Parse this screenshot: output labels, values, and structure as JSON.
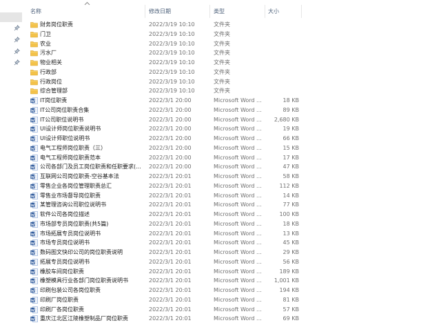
{
  "header": {
    "name_label": "名称",
    "date_label": "修改日期",
    "type_label": "类型",
    "size_label": "大小"
  },
  "icons": {
    "folder": "folder-icon",
    "word": "word-document-icon",
    "pin": "pin-icon",
    "sort": "chevron-up-icon"
  },
  "colors": {
    "folder": "#f3c24a",
    "word": "#2b579a",
    "selection": "#e5e5e5",
    "header_text": "#4c607a"
  },
  "files": [
    {
      "name": "财务岗位职责",
      "date": "2022/3/19 10:10",
      "type": "文件夹",
      "size": "",
      "kind": "folder"
    },
    {
      "name": "门卫",
      "date": "2022/3/19 10:10",
      "type": "文件夹",
      "size": "",
      "kind": "folder"
    },
    {
      "name": "农业",
      "date": "2022/3/19 10:10",
      "type": "文件夹",
      "size": "",
      "kind": "folder"
    },
    {
      "name": "污水厂",
      "date": "2022/3/19 10:10",
      "type": "文件夹",
      "size": "",
      "kind": "folder"
    },
    {
      "name": "物业相关",
      "date": "2022/3/19 10:10",
      "type": "文件夹",
      "size": "",
      "kind": "folder"
    },
    {
      "name": "行政部",
      "date": "2022/3/19 10:10",
      "type": "文件夹",
      "size": "",
      "kind": "folder"
    },
    {
      "name": "行政岗位",
      "date": "2022/3/19 10:10",
      "type": "文件夹",
      "size": "",
      "kind": "folder"
    },
    {
      "name": "综合管理部",
      "date": "2022/3/19 10:10",
      "type": "文件夹",
      "size": "",
      "kind": "folder"
    },
    {
      "name": "IT岗位职责",
      "date": "2022/3/1 20:00",
      "type": "Microsoft Word ...",
      "size": "18 KB",
      "kind": "word"
    },
    {
      "name": "IT公司岗位职责合集",
      "date": "2022/3/1 20:00",
      "type": "Microsoft Word ...",
      "size": "89 KB",
      "kind": "word"
    },
    {
      "name": "IT公司职位说明书",
      "date": "2022/3/1 20:00",
      "type": "Microsoft Word ...",
      "size": "2,680 KB",
      "kind": "word"
    },
    {
      "name": "UI设计师岗位职责说明书",
      "date": "2022/3/1 20:00",
      "type": "Microsoft Word ...",
      "size": "19 KB",
      "kind": "word"
    },
    {
      "name": "UI设计师职位说明书",
      "date": "2022/3/1 20:00",
      "type": "Microsoft Word ...",
      "size": "66 KB",
      "kind": "word"
    },
    {
      "name": "电气工程师岗位职责（三）",
      "date": "2022/3/1 20:00",
      "type": "Microsoft Word ...",
      "size": "15 KB",
      "kind": "word"
    },
    {
      "name": "电气工程师岗位职责范本",
      "date": "2022/3/1 20:00",
      "type": "Microsoft Word ...",
      "size": "17 KB",
      "kind": "word"
    },
    {
      "name": "公司各部门及员工岗位职责和任职要求(...",
      "date": "2022/3/1 20:00",
      "type": "Microsoft Word ...",
      "size": "47 KB",
      "kind": "word"
    },
    {
      "name": "互联网公司岗位职责-空谷基本法",
      "date": "2022/3/1 20:01",
      "type": "Microsoft Word ...",
      "size": "58 KB",
      "kind": "word"
    },
    {
      "name": "零售企业各岗位管理职责总汇",
      "date": "2022/3/1 20:01",
      "type": "Microsoft Word ...",
      "size": "112 KB",
      "kind": "word"
    },
    {
      "name": "零售业市场督导岗位职责",
      "date": "2022/3/1 20:01",
      "type": "Microsoft Word ...",
      "size": "14 KB",
      "kind": "word"
    },
    {
      "name": "某管理咨询公司职位说明书",
      "date": "2022/3/1 20:01",
      "type": "Microsoft Word ...",
      "size": "77 KB",
      "kind": "word"
    },
    {
      "name": "软件公司各岗位描述",
      "date": "2022/3/1 20:01",
      "type": "Microsoft Word ...",
      "size": "100 KB",
      "kind": "word"
    },
    {
      "name": "市场部专员岗位职责(共5篇)",
      "date": "2022/3/1 20:01",
      "type": "Microsoft Word ...",
      "size": "18 KB",
      "kind": "word"
    },
    {
      "name": "市场拓展专员岗位说明书",
      "date": "2022/3/1 20:01",
      "type": "Microsoft Word ...",
      "size": "13 KB",
      "kind": "word"
    },
    {
      "name": "市场专员岗位说明书",
      "date": "2022/3/1 20:01",
      "type": "Microsoft Word ...",
      "size": "45 KB",
      "kind": "word"
    },
    {
      "name": "数码图文快印公司的岗位职责说明",
      "date": "2022/3/1 20:01",
      "type": "Microsoft Word ...",
      "size": "29 KB",
      "kind": "word"
    },
    {
      "name": "拓展专员岗位说明书",
      "date": "2022/3/1 20:01",
      "type": "Microsoft Word ...",
      "size": "56 KB",
      "kind": "word"
    },
    {
      "name": "橡胶车间岗位职责",
      "date": "2022/3/1 20:01",
      "type": "Microsoft Word ...",
      "size": "189 KB",
      "kind": "word"
    },
    {
      "name": "橡塑模具行业各部门岗位职责说明书",
      "date": "2022/3/1 20:01",
      "type": "Microsoft Word ...",
      "size": "1,001 KB",
      "kind": "word"
    },
    {
      "name": "印刷包装公司各岗位职责",
      "date": "2022/3/1 20:01",
      "type": "Microsoft Word ...",
      "size": "194 KB",
      "kind": "word"
    },
    {
      "name": "印刷厂岗位职责",
      "date": "2022/3/1 20:01",
      "type": "Microsoft Word ...",
      "size": "81 KB",
      "kind": "word"
    },
    {
      "name": "印刷厂各岗位职责",
      "date": "2022/3/1 20:01",
      "type": "Microsoft Word ...",
      "size": "57 KB",
      "kind": "word"
    },
    {
      "name": "重庆江北区江陵橡塑制品厂岗位职责",
      "date": "2022/3/1 20:01",
      "type": "Microsoft Word ...",
      "size": "69 KB",
      "kind": "word"
    }
  ]
}
